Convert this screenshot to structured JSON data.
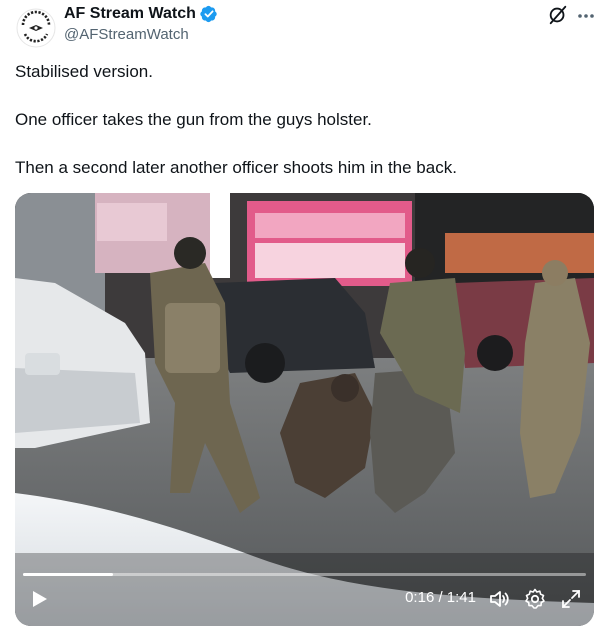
{
  "account": {
    "display_name": "AF Stream Watch",
    "handle": "@AFStreamWatch",
    "avatar_icon": "stream-watch-logo-icon",
    "verified_color": "#1d9bf0"
  },
  "tweet": {
    "paragraphs": [
      "Stabilised version.",
      "One officer takes the gun from the guys holster.",
      "Then a second later another officer shoots him in the back."
    ]
  },
  "video": {
    "time": "0:16 / 1:41",
    "progress_fraction": 0.16,
    "controls": [
      "play-icon",
      "volume-icon",
      "gear-icon",
      "expand-icon"
    ]
  },
  "colors": {
    "text": "#0f1419",
    "secondary": "#536471",
    "accent": "#1d9bf0"
  }
}
